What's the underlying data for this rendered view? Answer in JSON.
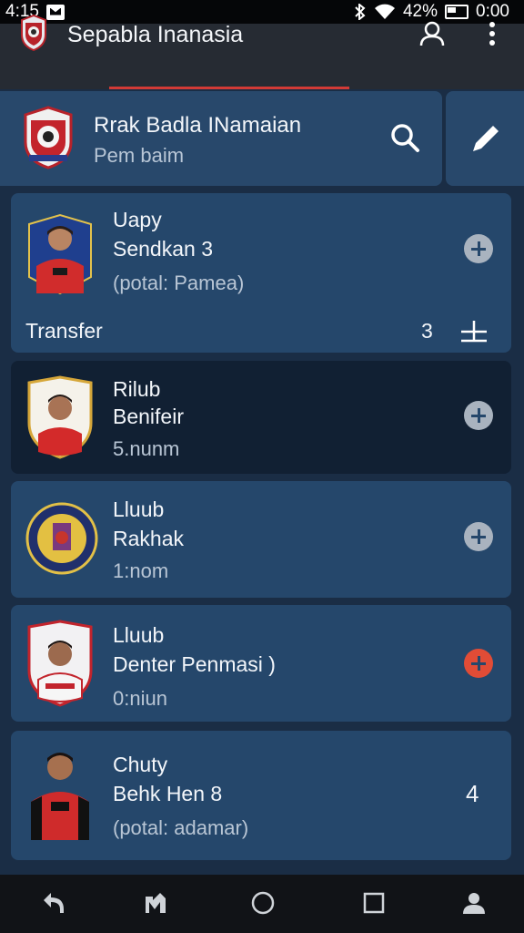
{
  "status_bar": {
    "time": "4:15",
    "battery": "42%",
    "clock": "0:00"
  },
  "app_bar": {
    "title": "Sepabla Inanasia"
  },
  "header": {
    "title": "Rrak Badla INamaian",
    "subtitle": "Pem baim"
  },
  "cards": [
    {
      "line1": "Uapy",
      "line2": "Sendkan 3",
      "line3": "(potal: Pamea)"
    },
    {
      "line1": "Rilub",
      "line2": "Benifeir",
      "line3": "5.nunm"
    },
    {
      "line1": "Lluub",
      "line2": "Rakhak",
      "line3": "1:nom"
    },
    {
      "line1": "Lluub",
      "line2": "Denter Penmasi )",
      "line3": "0:niun"
    },
    {
      "line1": "Chuty",
      "line2": "Behk Hen 8",
      "line3": "(potal: adamar)"
    }
  ],
  "transfer": {
    "label": "Transfer",
    "count": "3"
  },
  "last_card_count": "4",
  "colors": {
    "accent_red": "#e14c36",
    "card_blue": "#25476b",
    "card_dark": "#112033"
  },
  "icons": [
    "crest-icon",
    "user-icon",
    "more-icon",
    "search-icon",
    "edit-icon",
    "plus-icon",
    "transfer-icon",
    "back-icon",
    "recent-apps-icon",
    "home-icon",
    "overview-icon",
    "profile-icon"
  ]
}
